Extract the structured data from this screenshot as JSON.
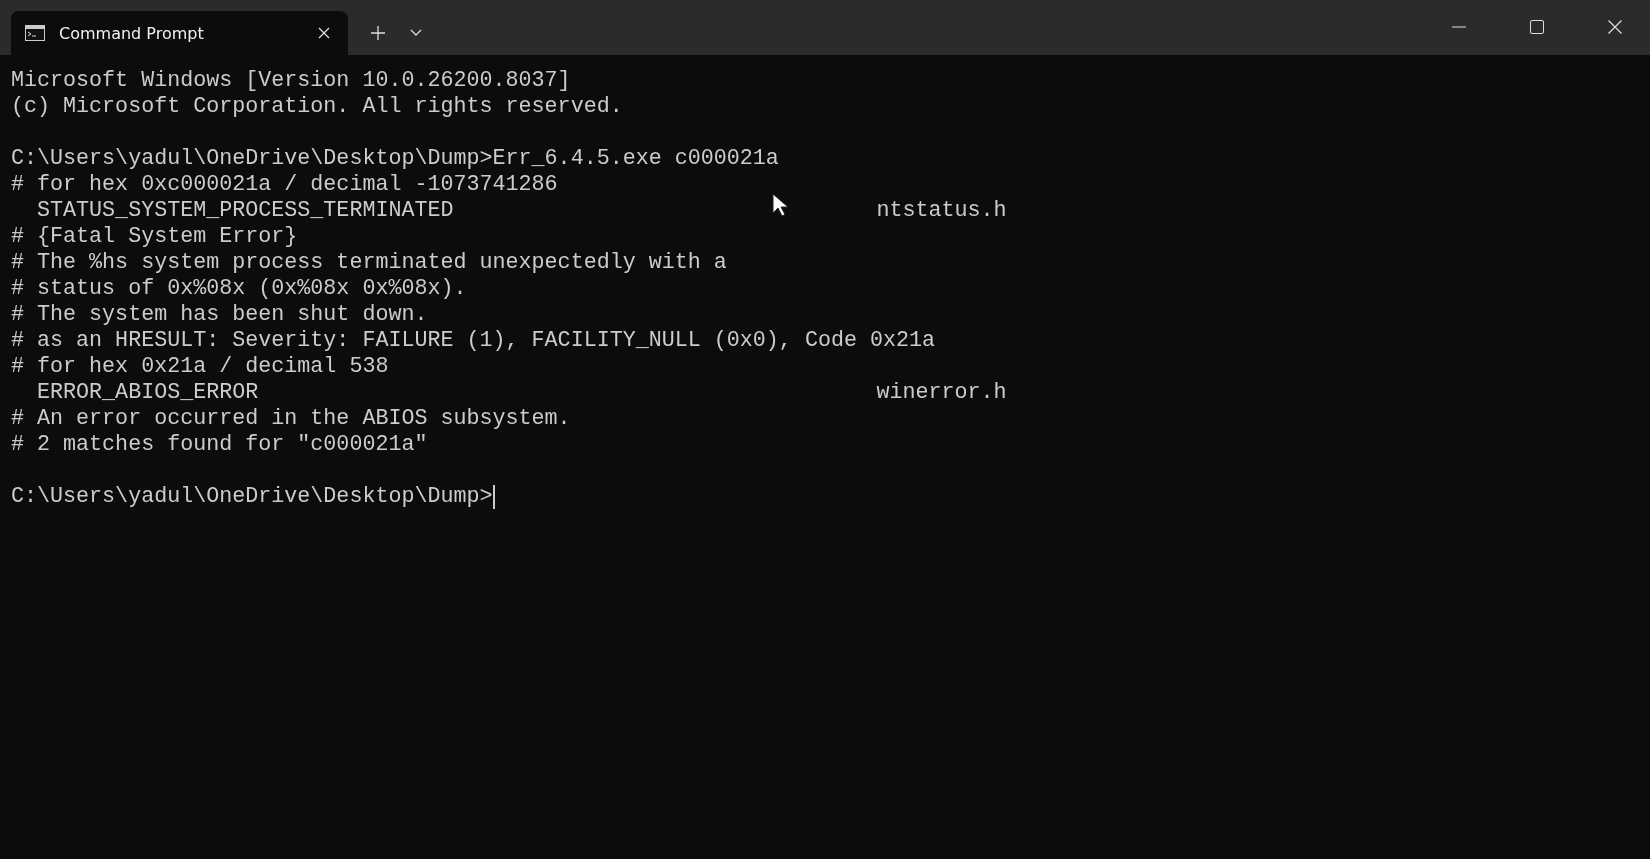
{
  "tabs": [
    {
      "title": "Command Prompt",
      "selected": true
    }
  ],
  "blocks": [
    [
      {
        "kind": "line",
        "text": "Microsoft Windows [Version 10.0.26200.8037]"
      },
      {
        "kind": "line",
        "text": "(c) Microsoft Corporation. All rights reserved."
      }
    ],
    [
      {
        "kind": "line",
        "text": "C:\\Users\\yadul\\OneDrive\\Desktop\\Dump>Err_6.4.5.exe c000021a"
      },
      {
        "kind": "line",
        "text": "# for hex 0xc000021a / decimal -1073741286"
      },
      {
        "kind": "entry",
        "text": "  STATUS_SYSTEM_PROCESS_TERMINATED",
        "file": "ntstatus.h"
      },
      {
        "kind": "line",
        "text": "# {Fatal System Error}"
      },
      {
        "kind": "line",
        "text": "# The %hs system process terminated unexpectedly with a"
      },
      {
        "kind": "line",
        "text": "# status of 0x%08x (0x%08x 0x%08x)."
      },
      {
        "kind": "line",
        "text": "# The system has been shut down."
      },
      {
        "kind": "line",
        "text": "# as an HRESULT: Severity: FAILURE (1), FACILITY_NULL (0x0), Code 0x21a"
      },
      {
        "kind": "line",
        "text": "# for hex 0x21a / decimal 538"
      },
      {
        "kind": "entry",
        "text": "  ERROR_ABIOS_ERROR",
        "file": "winerror.h"
      },
      {
        "kind": "line",
        "text": "# An error occurred in the ABIOS subsystem."
      },
      {
        "kind": "line",
        "text": "# 2 matches found for \"c000021a\""
      }
    ],
    [
      {
        "kind": "prompt",
        "text": "C:\\Users\\yadul\\OneDrive\\Desktop\\Dump>"
      }
    ]
  ]
}
